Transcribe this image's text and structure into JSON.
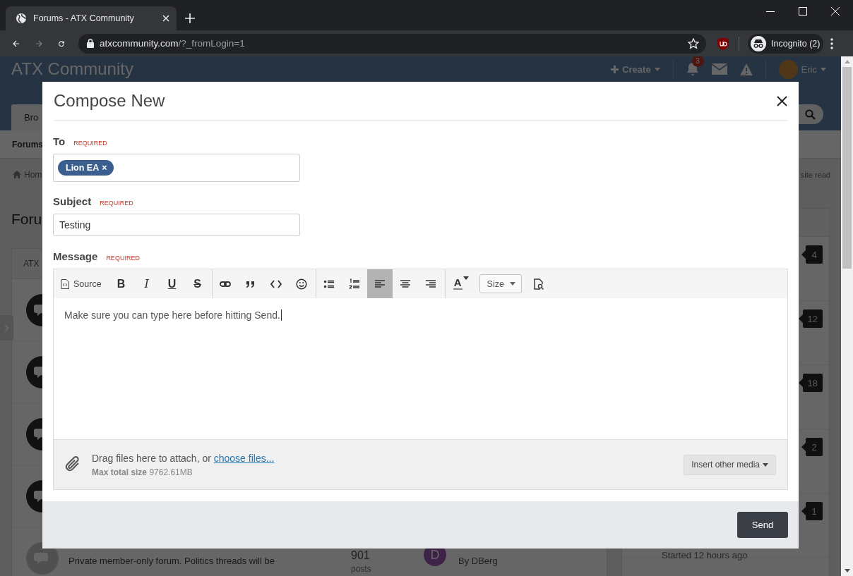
{
  "browser": {
    "tab_title": "Forums - ATX Community",
    "url_host": "atxcommunity.com",
    "url_path": "/?_fromLogin=1",
    "profile": "Incognito (2)"
  },
  "site": {
    "logo": "ATX Community",
    "create": "Create",
    "notification_count": "3",
    "user": "Eric",
    "nav_tab": "Bro",
    "subnav": "Forums",
    "breadcrumb": "Hom",
    "mark_read": "site read",
    "page_title": "Foru",
    "forum_header": "ATX",
    "forums": [
      {
        "kind": "covered",
        "unread": true
      },
      {
        "kind": "covered",
        "unread": true
      },
      {
        "kind": "covered",
        "unread": true
      },
      {
        "kind": "covered",
        "unread": true
      },
      {
        "kind": "visible",
        "unread": false,
        "description": "Private member-only forum. Politics threads will be",
        "count": "901",
        "count_label": "posts",
        "avatar": "D",
        "by": "By DBerg"
      }
    ],
    "topics": [
      {
        "replies": "4"
      },
      {
        "replies": "12"
      },
      {
        "replies": "18"
      },
      {
        "replies": "2"
      },
      {
        "replies": "1",
        "meta": "Started 12 hours ago"
      }
    ]
  },
  "modal": {
    "title": "Compose New",
    "to": {
      "label": "To",
      "required": "REQUIRED",
      "tokens": [
        {
          "name": "Lion EA",
          "remove": "×"
        }
      ]
    },
    "subject": {
      "label": "Subject",
      "required": "REQUIRED",
      "value": "Testing"
    },
    "message": {
      "label": "Message",
      "required": "REQUIRED",
      "toolbar": [
        {
          "items": [
            {
              "kind": "source",
              "label": "Source",
              "active": false
            },
            {
              "kind": "bold",
              "glyph": "B",
              "active": false
            },
            {
              "kind": "italic",
              "glyph": "I",
              "active": false
            },
            {
              "kind": "underline",
              "glyph": "U",
              "active": false
            },
            {
              "kind": "strike",
              "glyph": "S",
              "active": false
            }
          ]
        },
        {
          "items": [
            {
              "kind": "link",
              "active": false
            },
            {
              "kind": "quote",
              "active": false
            },
            {
              "kind": "code",
              "active": false
            },
            {
              "kind": "smiley",
              "active": false
            }
          ]
        },
        {
          "items": [
            {
              "kind": "bullets",
              "active": false
            },
            {
              "kind": "numbers",
              "active": false
            },
            {
              "kind": "align-left",
              "active": true
            },
            {
              "kind": "align-center",
              "active": false
            },
            {
              "kind": "align-right",
              "active": false
            }
          ]
        },
        {
          "items": [
            {
              "kind": "color",
              "glyph": "A",
              "active": false
            },
            {
              "kind": "size",
              "label": "Size",
              "active": false
            },
            {
              "kind": "preview",
              "active": false
            }
          ]
        }
      ],
      "body": "Make sure you can type here before hitting Send.",
      "attach_text": "Drag files here to attach, or",
      "attach_link": "choose files...",
      "max_label": "Max total size",
      "max_value": "9762.61MB",
      "media_button": "Insert other media"
    },
    "send": "Send"
  }
}
